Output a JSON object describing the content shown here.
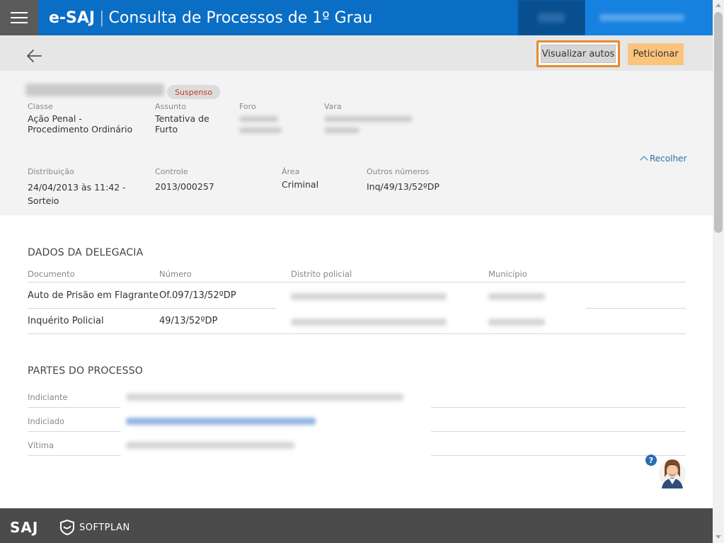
{
  "header": {
    "app_name": "e-SAJ",
    "separator": "|",
    "subtitle": "Consulta de Processos de 1º Grau",
    "bg_color": "#0a6ec5"
  },
  "actionbar": {
    "visualizar_label": "Visualizar autos",
    "peticionar_label": "Peticionar"
  },
  "processo": {
    "status": "Suspenso",
    "labels": {
      "classe": "Classe",
      "assunto": "Assunto",
      "foro": "Foro",
      "vara": "Vara",
      "distribuicao": "Distribuição",
      "controle": "Controle",
      "area": "Área",
      "outros_numeros": "Outros números"
    },
    "classe_line1": "Ação Penal -",
    "classe_line2": "Procedimento Ordinário",
    "assunto_line1": "Tentativa de",
    "assunto_line2": "Furto",
    "distribuicao_line1": "24/04/2013 às 11:42 -",
    "distribuicao_line2": "Sorteio",
    "controle": "2013/000257",
    "area": "Criminal",
    "outros_numeros": "Inq/49/13/52ºDP",
    "recolher_label": "Recolher"
  },
  "delegacia": {
    "title": "DADOS DA DELEGACIA",
    "columns": [
      "Documento",
      "Número",
      "Distrito policial",
      "Município"
    ],
    "rows": [
      {
        "documento": "Auto de Prisão em Flagrante",
        "numero": "Of.097/13/52ºDP"
      },
      {
        "documento": "Inquérito Policial",
        "numero": "49/13/52ºDP"
      }
    ]
  },
  "partes": {
    "title": "PARTES DO PROCESSO",
    "roles": [
      "Indiciante",
      "Indiciado",
      "Vítima"
    ]
  },
  "footer": {
    "logo_saj": "SAJ",
    "logo_softplan": "SOFTPLAN"
  },
  "icons": {
    "menu": "hamburger-icon",
    "back": "arrow-left-icon",
    "recolher": "chevron-up-icon",
    "help": "question-icon"
  }
}
